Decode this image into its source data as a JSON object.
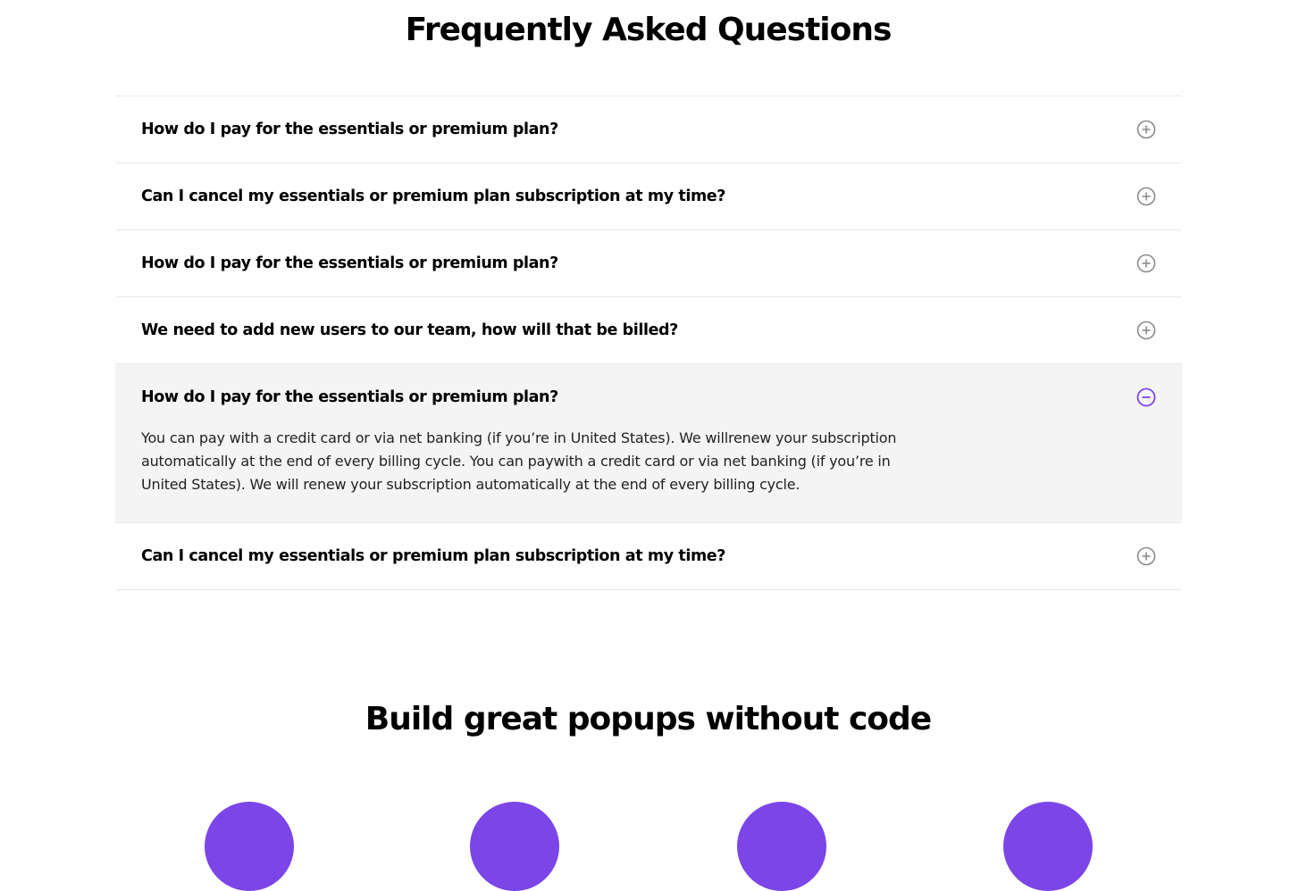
{
  "faq": {
    "title": "Frequently Asked Questions",
    "items": [
      {
        "question": "How do I pay for the essentials or premium plan?",
        "expanded": false,
        "icon": "plus-circle-icon"
      },
      {
        "question": "Can I cancel my essentials or premium plan subscription at my time?",
        "expanded": false,
        "icon": "plus-circle-icon"
      },
      {
        "question": "How do I pay for the essentials or premium plan?",
        "expanded": false,
        "icon": "plus-circle-icon"
      },
      {
        "question": "We need to add new users to our team, how will that be billed?",
        "expanded": false,
        "icon": "plus-circle-icon"
      },
      {
        "question": "How do I pay for the essentials or premium plan?",
        "expanded": true,
        "icon": "minus-circle-icon",
        "answer": "You can pay with a credit card or via net banking (if you’re in United States). We willrenew your subscription automatically at the end of every billing cycle. You can paywith a credit card or via net banking (if you’re in United States). We will renew your subscription automatically at the end of every billing cycle."
      },
      {
        "question": "Can I cancel my essentials or premium plan subscription at my time?",
        "expanded": false,
        "icon": "plus-circle-icon"
      }
    ]
  },
  "build": {
    "title": "Build great popups without code"
  },
  "colors": {
    "accent": "#7b45e8",
    "icon_gray": "#8a8a8a",
    "open_bg": "#f4f4f4",
    "divider": "#e8e8e8"
  }
}
